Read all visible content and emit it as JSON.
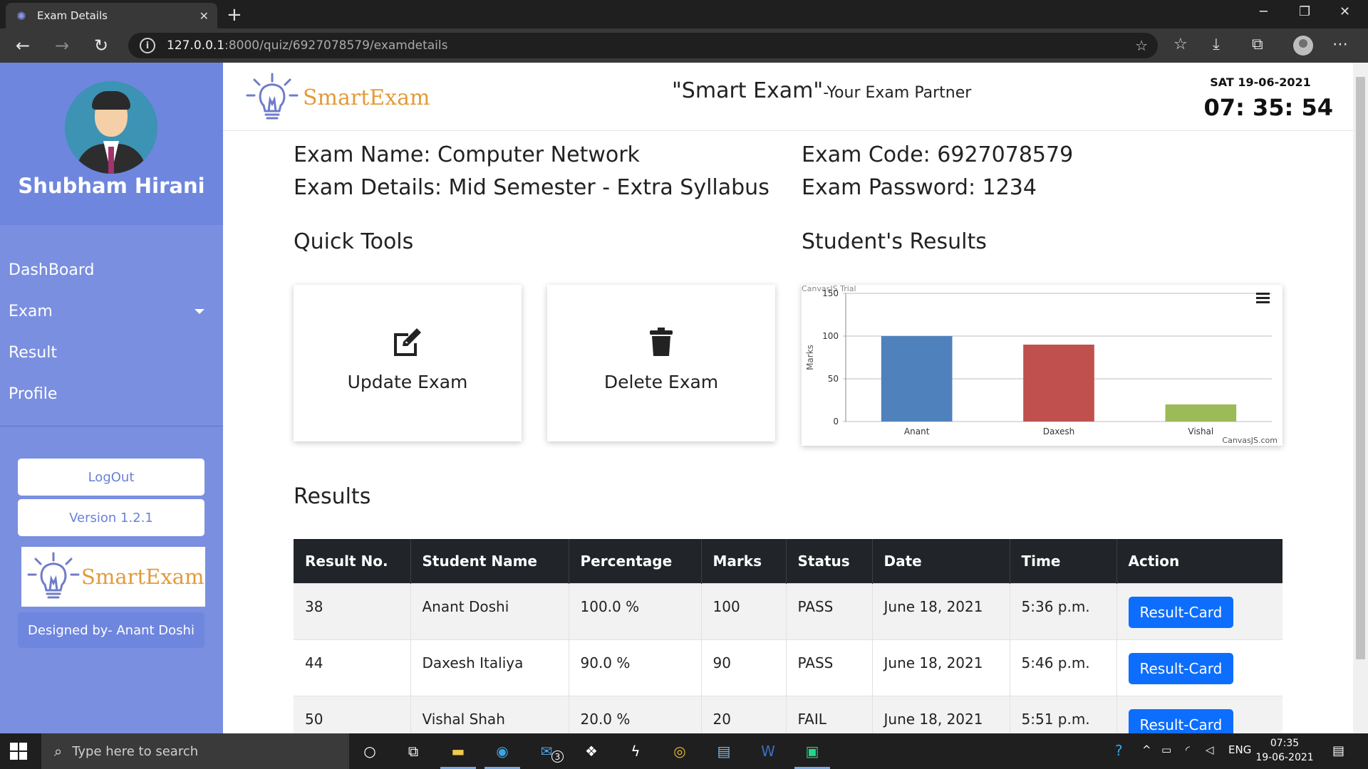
{
  "browser": {
    "tab_title": "Exam Details",
    "url_host": "127.0.0.1",
    "url_path": ":8000/quiz/6927078579/examdetails"
  },
  "sidebar": {
    "user_name": "Shubham Hirani",
    "menu": [
      {
        "label": "DashBoard"
      },
      {
        "label": "Exam"
      },
      {
        "label": "Result"
      },
      {
        "label": "Profile"
      }
    ],
    "logout_label": "LogOut",
    "version_label": "Version 1.2.1",
    "logo_text": "SmartExam",
    "designed_by": "Designed by- Anant Doshi"
  },
  "header": {
    "logo_text": "SmartExam",
    "title": "\"Smart Exam\"",
    "subtitle": "-Your Exam Partner",
    "date": "SAT 19-06-2021",
    "clock": "07: 35: 54"
  },
  "exam": {
    "name_line": "Exam Name: Computer Network",
    "details_line": "Exam Details: Mid Semester - Extra Syllabus",
    "code_line": "Exam Code: 6927078579",
    "password_line": "Exam Password: 1234"
  },
  "quick_tools": {
    "title": "Quick Tools",
    "update_label": "Update Exam",
    "delete_label": "Delete Exam"
  },
  "student_results": {
    "title": "Student's Results"
  },
  "chart_data": {
    "type": "bar",
    "categories": [
      "Anant",
      "Daxesh",
      "Vishal"
    ],
    "values": [
      100,
      90,
      20
    ],
    "colors": [
      "#4f81bc",
      "#c0504e",
      "#9bbb58"
    ],
    "ylabel": "Marks",
    "ylim": [
      0,
      150
    ],
    "yticks": [
      "0",
      "50",
      "100",
      "150"
    ],
    "watermark": "CanvasJS Trial",
    "credit": "CanvasJS.com",
    "grid": true
  },
  "results": {
    "title": "Results",
    "columns": [
      "Result No.",
      "Student Name",
      "Percentage",
      "Marks",
      "Status",
      "Date",
      "Time",
      "Action"
    ],
    "rows": [
      {
        "no": "38",
        "name": "Anant Doshi",
        "percentage": "100.0 %",
        "marks": "100",
        "status": "PASS",
        "date": "June 18, 2021",
        "time": "5:36 p.m.",
        "action": "Result-Card"
      },
      {
        "no": "44",
        "name": "Daxesh Italiya",
        "percentage": "90.0 %",
        "marks": "90",
        "status": "PASS",
        "date": "June 18, 2021",
        "time": "5:46 p.m.",
        "action": "Result-Card"
      },
      {
        "no": "50",
        "name": "Vishal Shah",
        "percentage": "20.0 %",
        "marks": "20",
        "status": "FAIL",
        "date": "June 18, 2021",
        "time": "5:51 p.m.",
        "action": "Result-Card"
      }
    ]
  },
  "taskbar": {
    "search_placeholder": "Type here to search",
    "mail_badge": "3",
    "language": "ENG",
    "time": "07:35",
    "date": "19-06-2021"
  },
  "colors": {
    "sidebar_bg": "#7a8fe0",
    "accent_blue": "#0d6efd",
    "table_header": "#212529",
    "logo_orange": "#e39a3a"
  }
}
